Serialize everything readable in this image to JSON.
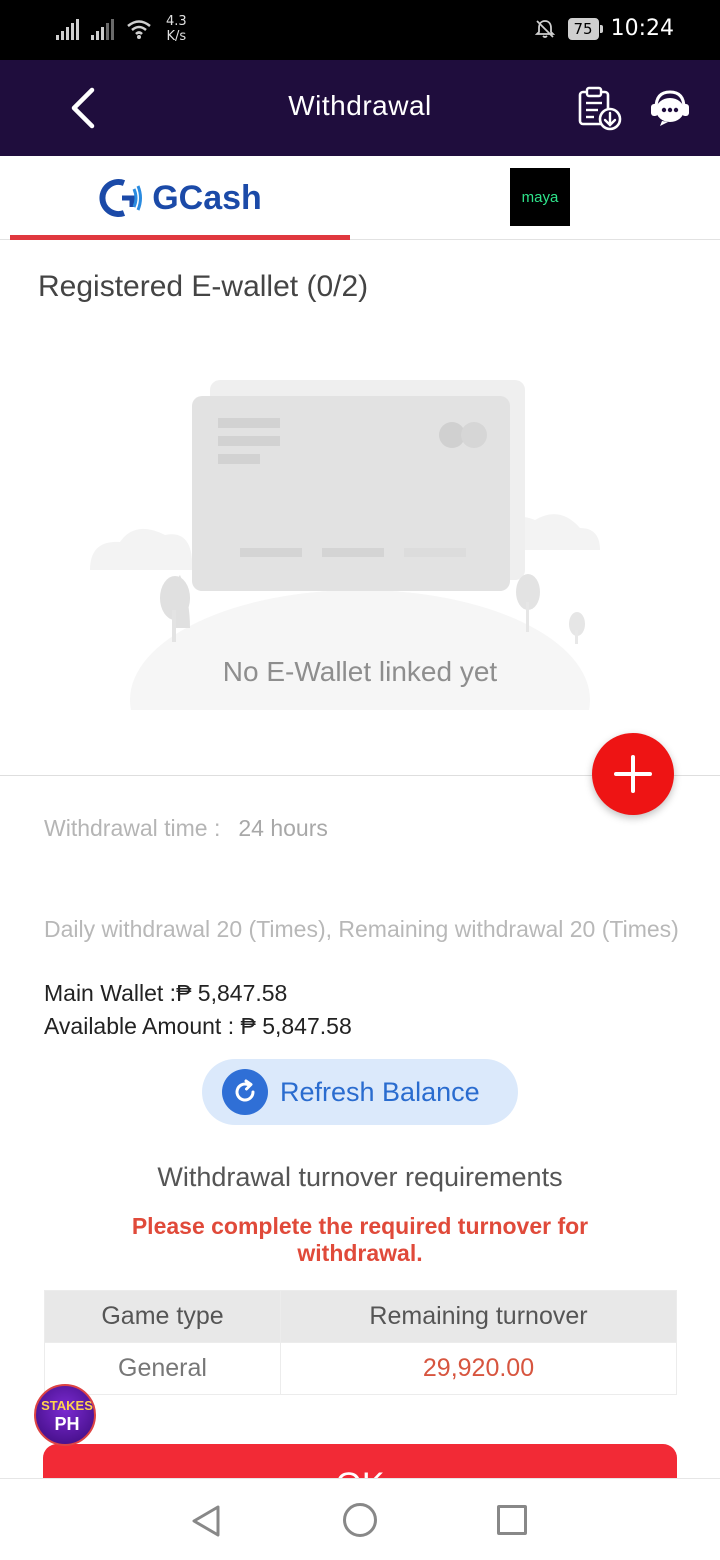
{
  "status_bar": {
    "net_speed_value": "4.3",
    "net_speed_unit": "K/s",
    "battery": "75",
    "time": "10:24"
  },
  "header": {
    "title": "Withdrawal"
  },
  "tabs": [
    {
      "label": "GCash",
      "active": true
    },
    {
      "label": "maya",
      "active": false
    }
  ],
  "wallet": {
    "section_title": "Registered E-wallet (0/2)",
    "empty_text": "No E-Wallet linked yet"
  },
  "info": {
    "withdrawal_time_label": "Withdrawal time :",
    "withdrawal_time_value": "24 hours",
    "daily_limit": "Daily withdrawal 20 (Times), Remaining withdrawal 20 (Times)",
    "main_wallet": "Main Wallet :₱ 5,847.58",
    "available_amount": "Available Amount : ₱ 5,847.58"
  },
  "refresh": {
    "label": "Refresh Balance"
  },
  "turnover": {
    "title": "Withdrawal turnover requirements",
    "warning": "Please complete the required turnover for withdrawal.",
    "headers": [
      "Game type",
      "Remaining turnover"
    ],
    "rows": [
      {
        "game_type": "General",
        "remaining": "29,920.00"
      }
    ]
  },
  "floating_badge": {
    "line1": "STAKES",
    "line2": "PH"
  },
  "ok_button": {
    "label": "OK"
  },
  "colors": {
    "header_bg": "#1f0d3d",
    "tab_indicator": "#e0383e",
    "add_button": "#ee1414",
    "ok_button": "#f22a36",
    "warning_text": "#e04a3a",
    "refresh_bg": "#dbe9fb",
    "refresh_text": "#2a6ccf"
  }
}
